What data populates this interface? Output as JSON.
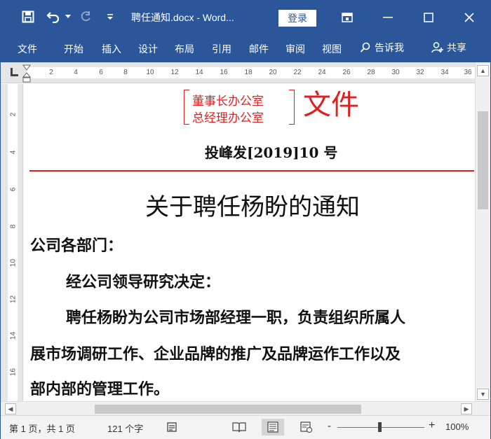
{
  "title_bar": {
    "doc_title": "聘任通知.docx  -  Word...",
    "login_label": "登录"
  },
  "ribbon": {
    "tabs": [
      "文件",
      "开始",
      "插入",
      "设计",
      "布局",
      "引用",
      "邮件",
      "审阅",
      "视图"
    ],
    "tell_me_label": "告诉我",
    "share_label": "共享"
  },
  "ruler": {
    "numbers": [
      "2",
      "4",
      "6",
      "8",
      "10",
      "12",
      "14",
      "16",
      "18",
      "20",
      "22",
      "24",
      "26",
      "28",
      "30",
      "32",
      "34",
      "36"
    ],
    "vertical_numbers": [
      "2",
      "4",
      "6",
      "8",
      "10",
      "12",
      "14",
      "16"
    ]
  },
  "document": {
    "units": [
      "董事长办公室",
      "总经理办公室"
    ],
    "file_word": "文件",
    "doc_number": "投峰发[2019]10 号",
    "title": "关于聘任杨盼的通知",
    "salutation": "公司各部门：",
    "para1": "经公司领导研究决定：",
    "para2_line1": "聘任杨盼为公司市场部经理一职，负责组织所属人",
    "para2_line2": "展市场调研工作、企业品牌的推广及品牌运作工作以及",
    "para2_line3": "部内部的管理工作。"
  },
  "status_bar": {
    "page_info": "第 1 页，共 1 页",
    "word_count": "121 个字",
    "zoom_minus": "-",
    "zoom_plus": "+",
    "zoom_level": "100%"
  },
  "colors": {
    "brand": "#2b579a",
    "red_header": "#e02020"
  }
}
